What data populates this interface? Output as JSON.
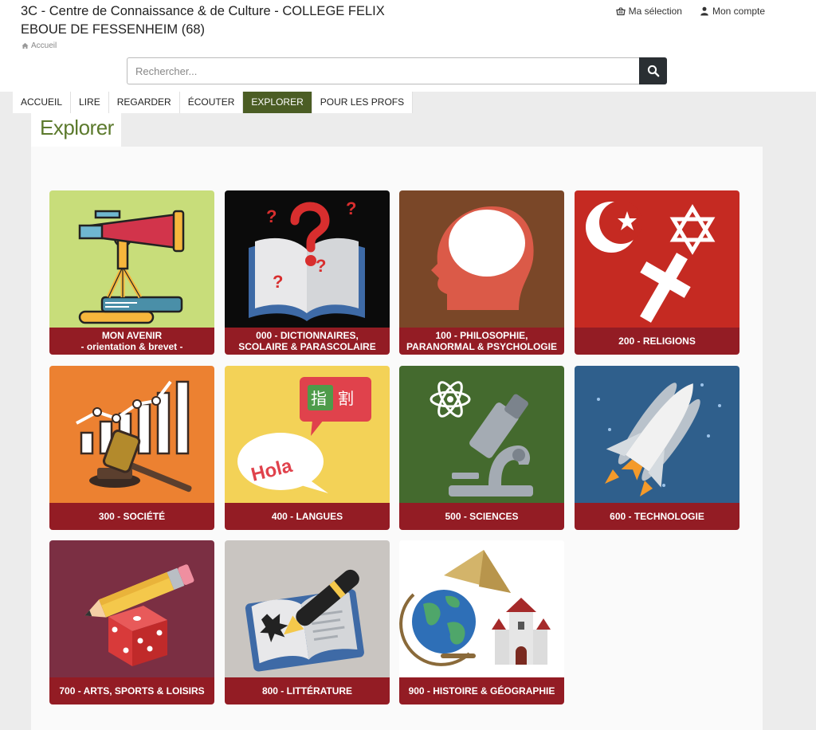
{
  "header": {
    "title": "3C - Centre de Connaissance & de Culture - COLLEGE FELIX EBOUE DE FESSENHEIM (68)",
    "breadcrumb": "Accueil",
    "links": {
      "selection": "Ma sélection",
      "account": "Mon compte"
    }
  },
  "search": {
    "placeholder": "Rechercher..."
  },
  "nav": {
    "items": [
      "ACCUEIL",
      "LIRE",
      "REGARDER",
      "ÉCOUTER",
      "EXPLORER",
      "POUR LES PROFS"
    ],
    "active": "EXPLORER"
  },
  "page": {
    "title": "Explorer"
  },
  "tiles": [
    {
      "label": "MON AVENIR\n- orientation & brevet -",
      "bg": "#c8dd7a",
      "icon": "telescope-on-books-icon"
    },
    {
      "label": "000 - DICTIONNAIRES,\nSCOLAIRE & PARASCOLAIRE",
      "bg": "#0b0b0b",
      "icon": "question-book-icon"
    },
    {
      "label": "100 - PHILOSOPHIE,\nPARANORMAL & PSYCHOLOGIE",
      "bg": "#7a4728",
      "icon": "head-profile-icon"
    },
    {
      "label": "200 - RELIGIONS",
      "bg": "#c52a22",
      "icon": "religion-symbols-icon"
    },
    {
      "label": "300 - SOCIÉTÉ",
      "bg": "#ec8131",
      "icon": "gavel-chart-icon"
    },
    {
      "label": "400 - LANGUES",
      "bg": "#f3d257",
      "icon": "speech-bubbles-icon"
    },
    {
      "label": "500 - SCIENCES",
      "bg": "#446a2e",
      "icon": "microscope-atom-icon"
    },
    {
      "label": "600 - TECHNOLOGIE",
      "bg": "#2f5f8c",
      "icon": "space-shuttle-icon"
    },
    {
      "label": "700 - ARTS, SPORTS & LOISIRS",
      "bg": "#7b2f43",
      "icon": "pencil-dice-icon"
    },
    {
      "label": "800 - LITTÉRATURE",
      "bg": "#c9c5c1",
      "icon": "pen-book-icon"
    },
    {
      "label": "900 - HISTOIRE & GÉOGRAPHIE",
      "bg": "#ffffff",
      "icon": "globe-castle-icon"
    }
  ],
  "colors": {
    "active_nav": "#4b5d24",
    "title_green": "#5c7a2d",
    "label_red": "#931c24",
    "search_button": "#2a2f33"
  }
}
